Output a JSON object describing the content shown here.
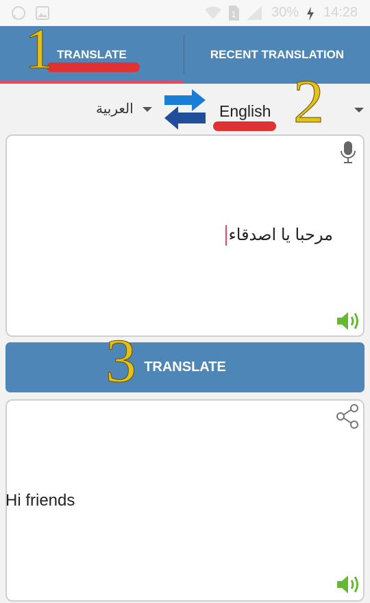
{
  "status_bar": {
    "battery": "30%",
    "time": "14:28"
  },
  "tabs": {
    "translate": "TRANSLATE",
    "recent": "RECENT TRANSLATION"
  },
  "languages": {
    "source": "العربية",
    "target": "English"
  },
  "input": {
    "text": "مرحبا يا اصدقاء"
  },
  "button": {
    "translate": "TRANSLATE"
  },
  "output": {
    "text": "Hi friends"
  },
  "annotations": {
    "one": "1",
    "two": "2",
    "three": "3"
  },
  "colors": {
    "primary": "#4f86b8",
    "tab_indicator": "#e5495f",
    "marker": "#e03232",
    "speaker": "#66b832",
    "annotation": "#e1c21a"
  },
  "icons": [
    "whatsapp-icon",
    "image-icon",
    "wifi-icon",
    "sim-icon",
    "signal-icon",
    "battery-charging-icon",
    "swap-languages-icon",
    "microphone-icon",
    "speaker-icon",
    "share-icon"
  ]
}
